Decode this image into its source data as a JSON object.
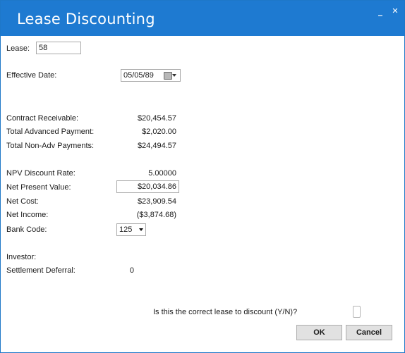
{
  "window": {
    "title": "Lease Discounting",
    "minimize_glyph": "_",
    "close_glyph": "✕"
  },
  "form": {
    "lease": {
      "label": "Lease:",
      "value": "58"
    },
    "effective_date": {
      "label": "Effective Date:",
      "value": "05/05/89"
    },
    "contract_receivable": {
      "label": "Contract Receivable:",
      "value": "$20,454.57"
    },
    "total_advanced_payment": {
      "label": "Total Advanced Payment:",
      "value": "$2,020.00"
    },
    "total_non_adv_payments": {
      "label": "Total Non-Adv Payments:",
      "value": "$24,494.57"
    },
    "npv_discount_rate": {
      "label": "NPV Discount Rate:",
      "value": "5.00000"
    },
    "net_present_value": {
      "label": "Net Present Value:",
      "value": "$20,034.86"
    },
    "net_cost": {
      "label": "Net Cost:",
      "value": "$23,909.54"
    },
    "net_income": {
      "label": "Net Income:",
      "value": "($3,874.68)"
    },
    "bank_code": {
      "label": "Bank Code:",
      "value": "125"
    },
    "investor": {
      "label": "Investor:",
      "value": ""
    },
    "settlement_deferral": {
      "label": "Settlement Deferral:",
      "value": "0"
    }
  },
  "prompt": {
    "question": "Is this the correct lease to discount (Y/N)?",
    "answer": ""
  },
  "buttons": {
    "ok": "OK",
    "cancel": "Cancel"
  },
  "colors": {
    "titlebar": "#1e7ad1",
    "border": "#1e78c8"
  }
}
